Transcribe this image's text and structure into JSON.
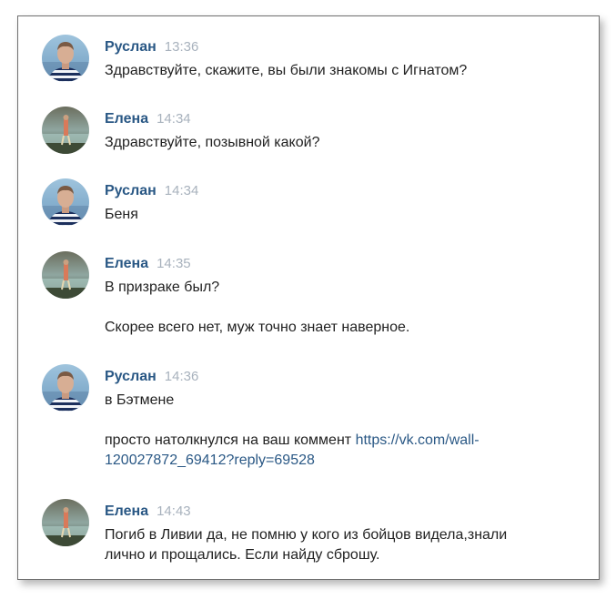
{
  "messages": [
    {
      "author": "Руслан",
      "time": "13:36",
      "avatar_icon": "man-avatar-icon",
      "lines": [
        "Здравствуйте, скажите, вы были знакомы с Игнатом?"
      ]
    },
    {
      "author": "Елена",
      "time": "14:34",
      "avatar_icon": "woman-avatar-icon",
      "lines": [
        "Здравствуйте, позывной какой?"
      ]
    },
    {
      "author": "Руслан",
      "time": "14:34",
      "avatar_icon": "man-avatar-icon",
      "lines": [
        "Беня"
      ]
    },
    {
      "author": "Елена",
      "time": "14:35",
      "avatar_icon": "woman-avatar-icon",
      "lines": [
        "В призраке был?",
        "Скорее всего нет, муж точно знает наверное."
      ]
    },
    {
      "author": "Руслан",
      "time": "14:36",
      "avatar_icon": "man-avatar-icon",
      "lines": [
        "в Бэтмене"
      ],
      "link_line": {
        "text": "просто натолкнулся на ваш коммент ",
        "link_part1": "https://vk.com/wall-",
        "link_part2": "120027872_69412?reply=69528"
      }
    },
    {
      "author": "Елена",
      "time": "14:43",
      "avatar_icon": "woman-avatar-icon",
      "lines": [
        "Погиб в Ливии да, не помню у кого из бойцов видела,знали",
        "лично и прощались. Если найду сброшу."
      ]
    }
  ],
  "colors": {
    "author": "#2a5885",
    "time": "#a8b2bd",
    "text": "#222222",
    "link": "#2a5885"
  }
}
